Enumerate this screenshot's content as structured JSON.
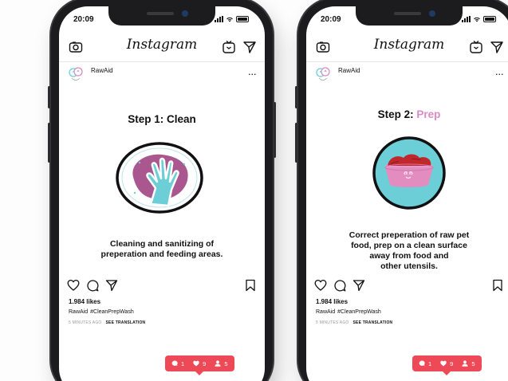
{
  "colors": {
    "accent_pink": "#d98cc4",
    "notif_red": "#ee4956",
    "teal": "#6ccfd8",
    "plum": "#a9578e"
  },
  "status_bar": {
    "time": "20:09"
  },
  "app": {
    "name": "Instagram"
  },
  "posts": [
    {
      "username": "RawAid",
      "more": "...",
      "step_title": "Step 1: Clean",
      "step_accent": "",
      "caption_lines": [
        "Cleaning and sanitizing of",
        "preperation and feeding areas."
      ],
      "illustration_icon": "glove-cleaning-icon",
      "likes": "1.984 likes",
      "post_user": "RawAid",
      "hashtag": "#CleanPrepWash",
      "time_ago": "5 MINUTES AGO",
      "see_translation": "SEE TRANSLATION",
      "notif": {
        "comments": "1",
        "likes": "9",
        "follows": "5"
      }
    },
    {
      "username": "RawAid",
      "more": "...",
      "step_title": "Step 2: ",
      "step_accent": "Prep",
      "caption_lines": [
        "Correct preperation of raw pet",
        "food, prep on a clean surface",
        "away from food and",
        "other utensils."
      ],
      "illustration_icon": "pet-food-bowl-icon",
      "likes": "1.984 likes",
      "post_user": "RawAid",
      "hashtag": "#CleanPrepWash",
      "time_ago": "5 MINUTES AGO",
      "see_translation": "SEE TRANSLATION",
      "notif": {
        "comments": "1",
        "likes": "9",
        "follows": "5"
      }
    }
  ]
}
